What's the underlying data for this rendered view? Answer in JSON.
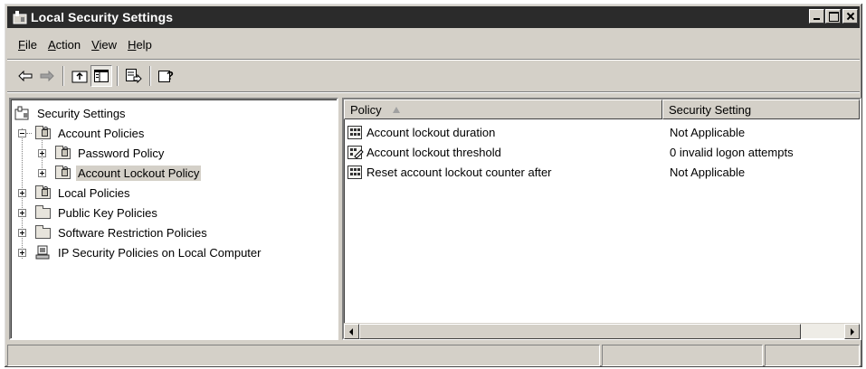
{
  "window": {
    "title": "Local Security Settings"
  },
  "menu": {
    "items": [
      {
        "label": "File",
        "u": "F",
        "rest": "ile"
      },
      {
        "label": "Action",
        "u": "A",
        "rest": "ction"
      },
      {
        "label": "View",
        "u": "V",
        "rest": "iew"
      },
      {
        "label": "Help",
        "u": "H",
        "rest": "elp"
      }
    ]
  },
  "toolbar": {
    "buttons": [
      "back-icon",
      "forward-icon",
      "up-folder-icon",
      "show-hide-tree-icon",
      "export-list-icon",
      "help-icon"
    ]
  },
  "tree": {
    "root": "Security Settings",
    "account_policies": "Account Policies",
    "password_policy": "Password Policy",
    "account_lockout_policy": "Account Lockout Policy",
    "local_policies": "Local Policies",
    "public_key_policies": "Public Key Policies",
    "software_restriction_policies": "Software Restriction Policies",
    "ip_security_policies": "IP Security Policies on Local Computer",
    "selected": "Account Lockout Policy"
  },
  "list": {
    "columns": [
      "Policy",
      "Security Setting"
    ],
    "sort_column": "Policy",
    "rows": [
      {
        "policy": "Account lockout duration",
        "setting": "Not Applicable",
        "icon": "policy-grid-icon"
      },
      {
        "policy": "Account lockout threshold",
        "setting": "0 invalid logon attempts",
        "icon": "policy-edit-icon"
      },
      {
        "policy": "Reset account lockout counter after",
        "setting": "Not Applicable",
        "icon": "policy-grid-icon"
      }
    ]
  },
  "colors": {
    "titlebar": "#2b2b2b",
    "face": "#d4d0c8",
    "selected_item_bg": "#d4d0c8"
  }
}
